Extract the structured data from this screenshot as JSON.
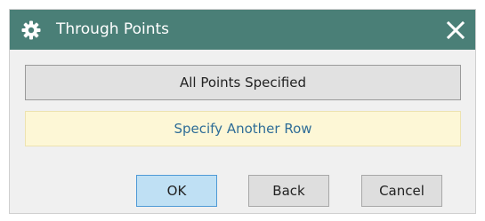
{
  "window": {
    "title": "Through Points",
    "title_icon": "gear-icon",
    "close_icon": "close-icon"
  },
  "options": {
    "all_points_label": "All Points Specified",
    "another_row_label": "Specify Another Row"
  },
  "footer": {
    "ok_label": "OK",
    "back_label": "Back",
    "cancel_label": "Cancel"
  },
  "colors": {
    "titlebar": "#4a7f77",
    "dialog_bg": "#f0f0f0",
    "highlight_bg": "#fdf7d6",
    "link_text": "#2f6d97",
    "ok_bg": "#bfe0f4",
    "ok_border": "#4f9ad6"
  }
}
